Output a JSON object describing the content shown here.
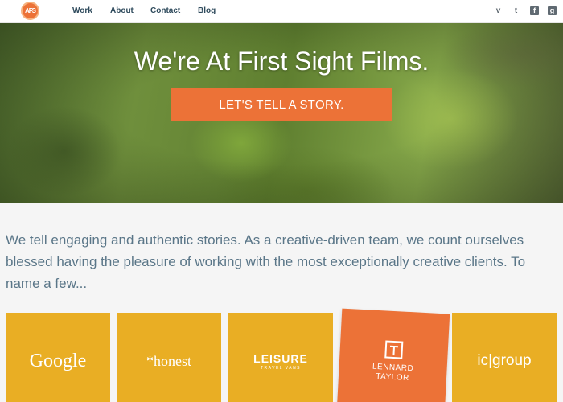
{
  "nav": {
    "logo_text": "AFS",
    "links": [
      "Work",
      "About",
      "Contact",
      "Blog"
    ],
    "social": [
      {
        "icon": "vimeo-icon",
        "glyph": "v"
      },
      {
        "icon": "twitter-icon",
        "glyph": "t"
      },
      {
        "icon": "facebook-icon",
        "glyph": "f"
      },
      {
        "icon": "googleplus-icon",
        "glyph": "g"
      }
    ]
  },
  "hero": {
    "title": "We're At First Sight Films.",
    "cta_label": "LET'S TELL A STORY."
  },
  "intro": {
    "text": "We tell engaging and authentic stories. As a creative-driven team, we count ourselves blessed having the pleasure of working with the most exceptionally creative clients. To name a few..."
  },
  "clients": {
    "google": "Google",
    "honest": "*honest",
    "leisure_main": "LEISURE",
    "leisure_sub": "TRAVEL VANS",
    "lennard_line1": "LENNARD",
    "lennard_line2": "TAYLOR",
    "icgroup": "ic|group"
  },
  "colors": {
    "accent_orange": "#ec7237",
    "tile_yellow": "#e9ae24",
    "nav_text": "#2e4a5c",
    "intro_text": "#5a7688"
  }
}
